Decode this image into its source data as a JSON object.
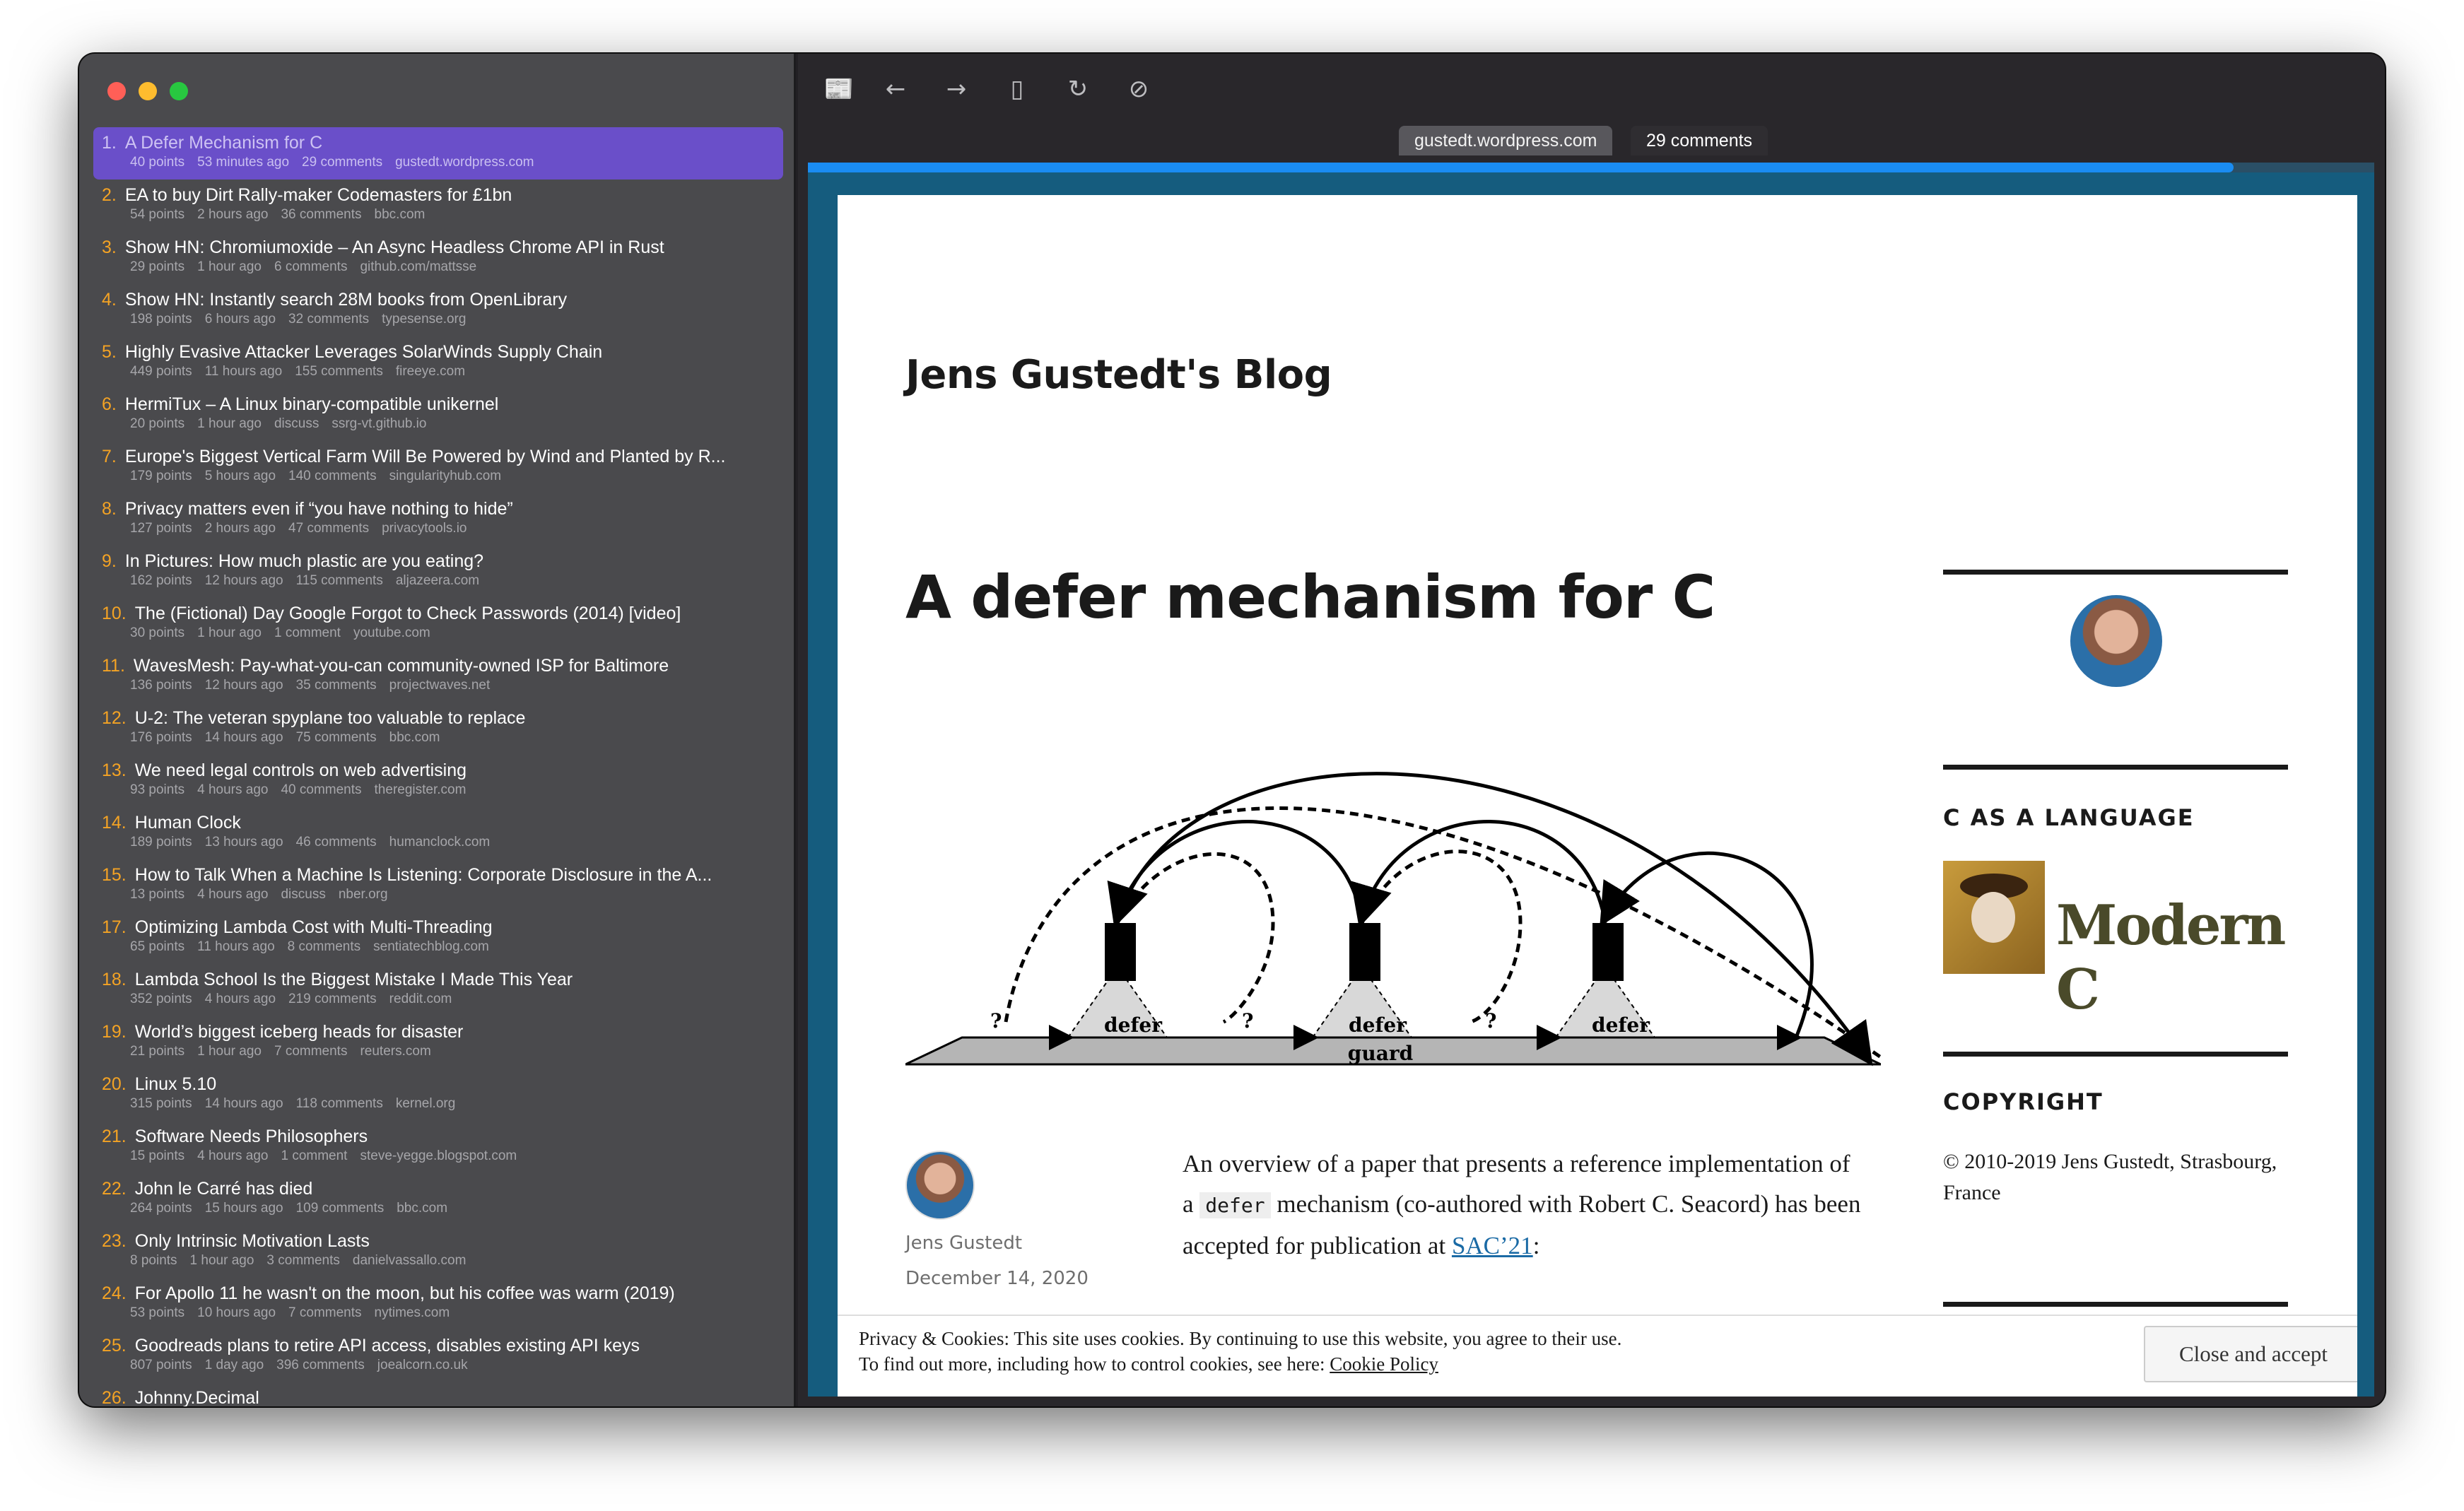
{
  "stories": [
    {
      "n": "1.",
      "title": "A Defer Mechanism for C",
      "points": "40 points",
      "age": "53 minutes ago",
      "comments": "29 comments",
      "domain": "gustedt.wordpress.com",
      "selected": true
    },
    {
      "n": "2.",
      "title": "EA to buy Dirt Rally-maker Codemasters for £1bn",
      "points": "54 points",
      "age": "2 hours ago",
      "comments": "36 comments",
      "domain": "bbc.com"
    },
    {
      "n": "3.",
      "title": "Show HN: Chromiumoxide – An Async Headless Chrome API in Rust",
      "points": "29 points",
      "age": "1 hour ago",
      "comments": "6 comments",
      "domain": "github.com/mattsse"
    },
    {
      "n": "4.",
      "title": "Show HN: Instantly search 28M books from OpenLibrary",
      "points": "198 points",
      "age": "6 hours ago",
      "comments": "32 comments",
      "domain": "typesense.org"
    },
    {
      "n": "5.",
      "title": "Highly Evasive Attacker Leverages SolarWinds Supply Chain",
      "points": "449 points",
      "age": "11 hours ago",
      "comments": "155 comments",
      "domain": "fireeye.com"
    },
    {
      "n": "6.",
      "title": "HermiTux – A Linux binary-compatible unikernel",
      "points": "20 points",
      "age": "1 hour ago",
      "comments": "discuss",
      "domain": "ssrg-vt.github.io"
    },
    {
      "n": "7.",
      "title": "Europe's Biggest Vertical Farm Will Be Powered by Wind and Planted by R...",
      "points": "179 points",
      "age": "5 hours ago",
      "comments": "140 comments",
      "domain": "singularityhub.com"
    },
    {
      "n": "8.",
      "title": "Privacy matters even if “you have nothing to hide”",
      "points": "127 points",
      "age": "2 hours ago",
      "comments": "47 comments",
      "domain": "privacytools.io"
    },
    {
      "n": "9.",
      "title": "In Pictures: How much plastic are you eating?",
      "points": "162 points",
      "age": "12 hours ago",
      "comments": "115 comments",
      "domain": "aljazeera.com"
    },
    {
      "n": "10.",
      "title": "The (Fictional) Day Google Forgot to Check Passwords (2014) [video]",
      "points": "30 points",
      "age": "1 hour ago",
      "comments": "1 comment",
      "domain": "youtube.com"
    },
    {
      "n": "11.",
      "title": "WavesMesh: Pay-what-you-can community-owned ISP for Baltimore",
      "points": "136 points",
      "age": "12 hours ago",
      "comments": "35 comments",
      "domain": "projectwaves.net"
    },
    {
      "n": "12.",
      "title": "U-2: The veteran spyplane too valuable to replace",
      "points": "176 points",
      "age": "14 hours ago",
      "comments": "75 comments",
      "domain": "bbc.com"
    },
    {
      "n": "13.",
      "title": "We need legal controls on web advertising",
      "points": "93 points",
      "age": "4 hours ago",
      "comments": "40 comments",
      "domain": "theregister.com"
    },
    {
      "n": "14.",
      "title": "Human Clock",
      "points": "189 points",
      "age": "13 hours ago",
      "comments": "46 comments",
      "domain": "humanclock.com"
    },
    {
      "n": "15.",
      "title": "How to Talk When a Machine Is Listening: Corporate Disclosure in the A...",
      "points": "13 points",
      "age": "4 hours ago",
      "comments": "discuss",
      "domain": "nber.org"
    },
    {
      "n": "17.",
      "title": "Optimizing Lambda Cost with Multi-Threading",
      "points": "65 points",
      "age": "11 hours ago",
      "comments": "8 comments",
      "domain": "sentiatechblog.com"
    },
    {
      "n": "18.",
      "title": "Lambda School Is the Biggest Mistake I Made This Year",
      "points": "352 points",
      "age": "4 hours ago",
      "comments": "219 comments",
      "domain": "reddit.com"
    },
    {
      "n": "19.",
      "title": "World’s biggest iceberg heads for disaster",
      "points": "21 points",
      "age": "1 hour ago",
      "comments": "7 comments",
      "domain": "reuters.com"
    },
    {
      "n": "20.",
      "title": "Linux 5.10",
      "points": "315 points",
      "age": "14 hours ago",
      "comments": "118 comments",
      "domain": "kernel.org"
    },
    {
      "n": "21.",
      "title": "Software Needs Philosophers",
      "points": "15 points",
      "age": "4 hours ago",
      "comments": "1 comment",
      "domain": "steve-yegge.blogspot.com"
    },
    {
      "n": "22.",
      "title": "John le Carré has died",
      "points": "264 points",
      "age": "15 hours ago",
      "comments": "109 comments",
      "domain": "bbc.com"
    },
    {
      "n": "23.",
      "title": "Only Intrinsic Motivation Lasts",
      "points": "8 points",
      "age": "1 hour ago",
      "comments": "3 comments",
      "domain": "danielvassallo.com"
    },
    {
      "n": "24.",
      "title": "For Apollo 11 he wasn't on the moon, but his coffee was warm (2019)",
      "points": "53 points",
      "age": "10 hours ago",
      "comments": "7 comments",
      "domain": "nytimes.com"
    },
    {
      "n": "25.",
      "title": "Goodreads plans to retire API access, disables existing API keys",
      "points": "807 points",
      "age": "1 day ago",
      "comments": "396 comments",
      "domain": "joealcorn.co.uk"
    },
    {
      "n": "26.",
      "title": "Johnny.Decimal",
      "points": "",
      "age": "",
      "comments": "",
      "domain": ""
    }
  ],
  "toolbar": {
    "reader_icon": "📰",
    "back_icon": "←",
    "forward_icon": "→",
    "sidebar_icon": "▯",
    "reload_icon": "↻",
    "compass_icon": "⊘"
  },
  "tabs": {
    "active": "gustedt.wordpress.com",
    "other": "29 comments"
  },
  "progress_fraction": 0.91,
  "page": {
    "blog_title": "Jens Gustedt's Blog",
    "post_title": "A defer mechanism for C",
    "author": "Jens Gustedt",
    "date": "December 14, 2020",
    "excerpt_1": "An overview of a paper that presents a reference implementation of a ",
    "excerpt_code": "defer",
    "excerpt_2": " mechanism (co-authored with Robert C. Seacord) has been accepted for publication at ",
    "excerpt_link": "SAC’21",
    "excerpt_3": ":",
    "widget_lang_title": "C AS A LANGUAGE",
    "book_title": "Modern C",
    "widget_copyright_title": "COPYRIGHT",
    "copyright_text": "© 2010-2019 Jens Gustedt, Strasbourg, France"
  },
  "diagram": {
    "defer_label": "defer",
    "guard_label": "guard",
    "question": "?"
  },
  "cookie": {
    "line1": "Privacy & Cookies: This site uses cookies. By continuing to use this website, you agree to their use.",
    "line2_prefix": "To find out more, including how to control cookies, see here: ",
    "line2_link": "Cookie Policy",
    "button": "Close and accept"
  },
  "colors": {
    "selection": "#6a4fc9",
    "number": "#f4a324",
    "frame": "#155c7e",
    "progress": "#1a8cf2"
  }
}
